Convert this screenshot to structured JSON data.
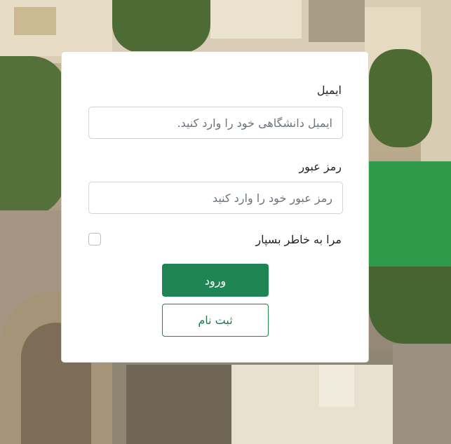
{
  "form": {
    "email_label": "ایمیل",
    "email_placeholder": "ایمیل دانشگاهی خود را وارد کنید.",
    "email_value": "",
    "password_label": "رمز عبور",
    "password_placeholder": "رمز عبور خود را وارد کنید",
    "password_value": "",
    "remember_label": "مرا به خاطر بسپار",
    "remember_checked": false,
    "login_label": "ورود",
    "register_label": "ثبت نام"
  },
  "colors": {
    "primary": "#1e8553",
    "card_background": "#ffffff"
  }
}
